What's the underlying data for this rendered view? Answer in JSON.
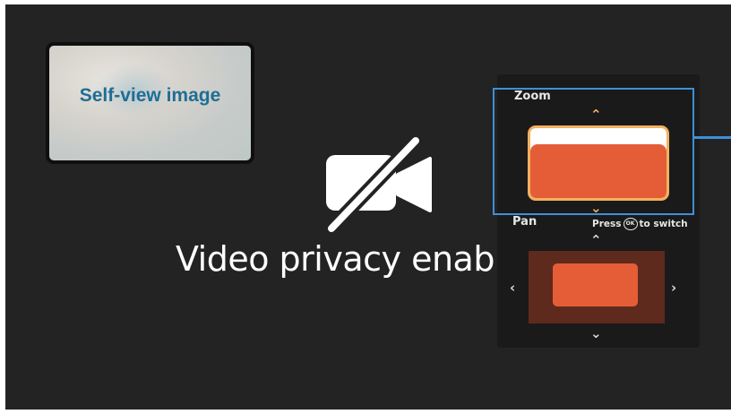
{
  "self_view": {
    "label": "Self-view image"
  },
  "privacy": {
    "icon": "camera-off-icon",
    "message": "Video privacy enabled"
  },
  "camera_control": {
    "zoom": {
      "label": "Zoom",
      "up_icon": "chevron-up-icon",
      "down_icon": "chevron-down-icon"
    },
    "pan": {
      "label": "Pan",
      "hint_prefix": "Press",
      "ok_key": "OK",
      "hint_suffix": "to switch",
      "icons": [
        "chevron-up-icon",
        "chevron-down-icon",
        "chevron-left-icon",
        "chevron-right-icon"
      ]
    }
  },
  "colors": {
    "background": "#232323",
    "panel": "#1a1a1a",
    "accent_orange": "#e55d36",
    "focus_border": "#f2b15f",
    "highlight_blue": "#3f8fd8",
    "self_view_label": "#1f6e94"
  }
}
